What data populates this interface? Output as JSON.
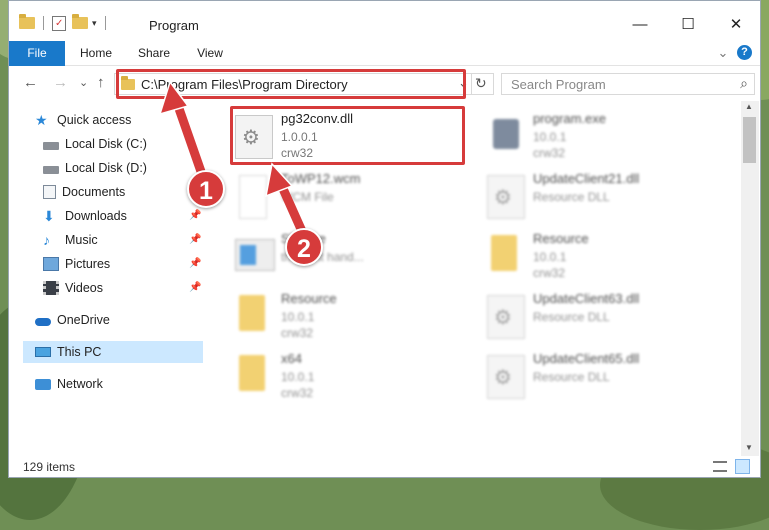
{
  "window": {
    "title": "Program",
    "controls": {
      "minimize": "—",
      "maximize": "☐",
      "close": "✕"
    }
  },
  "ribbon": {
    "tabs": [
      {
        "label": "File"
      },
      {
        "label": "Home"
      },
      {
        "label": "Share"
      },
      {
        "label": "View"
      }
    ],
    "expand": "⌄",
    "help": "?"
  },
  "navigation": {
    "back": "←",
    "forward": "→",
    "recent": "⌄",
    "up": "↑",
    "address": "C:\\Program Files\\Program Directory",
    "address_dropdown": "⌄",
    "refresh": "↻",
    "search_placeholder": "Search Program",
    "search_icon": "⌕"
  },
  "sidebar": {
    "items": [
      {
        "label": "Quick access",
        "icon": "star-icon"
      },
      {
        "label": "Local Disk (C:)",
        "icon": "drive-icon"
      },
      {
        "label": "Local Disk (D:)",
        "icon": "drive-icon"
      },
      {
        "label": "Documents",
        "icon": "documents-icon"
      },
      {
        "label": "Downloads",
        "icon": "download-icon",
        "pin": "📌"
      },
      {
        "label": "Music",
        "icon": "music-icon",
        "pin": "📌"
      },
      {
        "label": "Pictures",
        "icon": "pictures-icon",
        "pin": "📌"
      },
      {
        "label": "Videos",
        "icon": "videos-icon",
        "pin": "📌"
      },
      {
        "label": "OneDrive",
        "icon": "cloud-icon"
      },
      {
        "label": "This PC",
        "icon": "computer-icon"
      },
      {
        "label": "Network",
        "icon": "network-icon"
      }
    ]
  },
  "files": [
    {
      "name": "pg32conv.dll",
      "line2": "1.0.0.1",
      "line3": "crw32",
      "icon": "dll-gear-icon"
    },
    {
      "name": "program.exe",
      "line2": "10.0.1",
      "line3": "crw32",
      "icon": "exe-icon"
    },
    {
      "name": "ToWP12.wcm",
      "line2": "WCM File",
      "line3": "",
      "icon": "blank-file-icon"
    },
    {
      "name": "UpdateClient21.dll",
      "line2": "Resource DLL",
      "line3": "",
      "icon": "dll-gear-icon"
    },
    {
      "name": "STI.exe",
      "line2": "th event hand...",
      "line3": "",
      "icon": "app-window-icon"
    },
    {
      "name": "Resource",
      "line2": "10.0.1",
      "line3": "crw32",
      "icon": "folder-icon"
    },
    {
      "name": "Resource",
      "line2": "10.0.1",
      "line3": "crw32",
      "icon": "folder-icon"
    },
    {
      "name": "UpdateClient63.dll",
      "line2": "Resource DLL",
      "line3": "",
      "icon": "dll-gear-icon"
    },
    {
      "name": "x64",
      "line2": "10.0.1",
      "line3": "crw32",
      "icon": "folder-icon"
    },
    {
      "name": "UpdateClient65.dll",
      "line2": "Resource DLL",
      "line3": "",
      "icon": "dll-gear-icon"
    }
  ],
  "status": {
    "item_count": "129 items"
  },
  "annotations": {
    "step1": "1",
    "step2": "2"
  },
  "colors": {
    "accent": "#1979ca",
    "highlight": "#d63b3b",
    "selected": "#cce8ff"
  }
}
